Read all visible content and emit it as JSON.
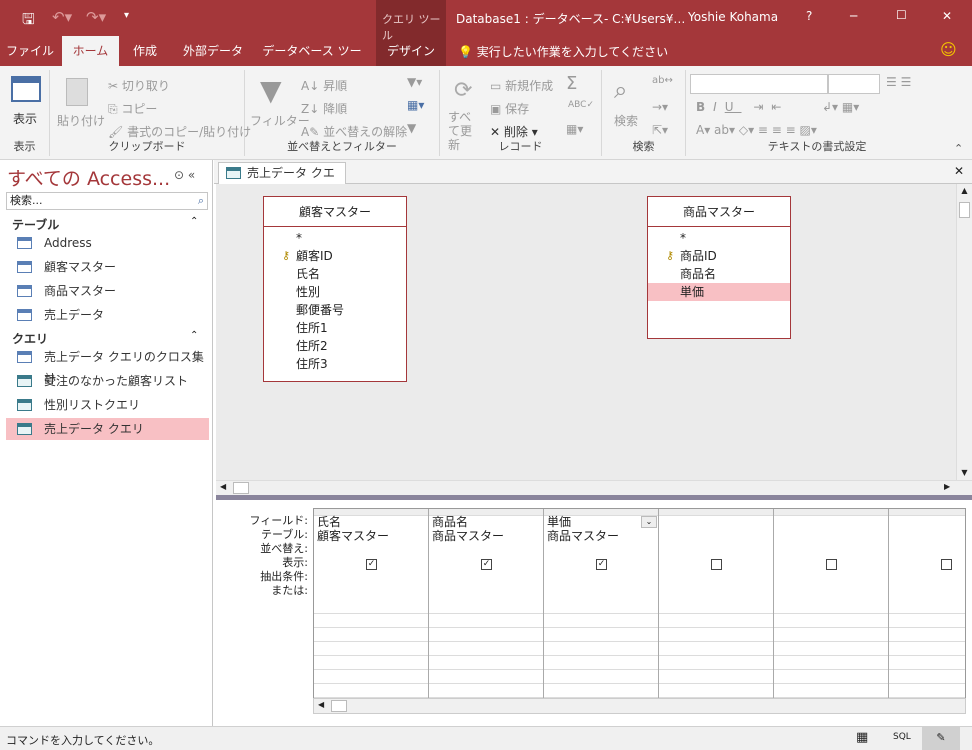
{
  "titlebar": {
    "context_tab": "クエリ ツール",
    "title": "Database1 : データベース- C:¥Users¥…",
    "user": "Yoshie Kohama",
    "help": "?",
    "minimize": "─",
    "maximize": "☐",
    "close": "✕"
  },
  "tabs": [
    {
      "label": "ファイル"
    },
    {
      "label": "ホーム"
    },
    {
      "label": "作成"
    },
    {
      "label": "外部データ"
    },
    {
      "label": "データベース ツール"
    },
    {
      "label": "デザイン"
    }
  ],
  "tell_me": "実行したい作業を入力してください",
  "ribbon": {
    "view": {
      "label": "表示",
      "group": "表示"
    },
    "clipboard": {
      "paste": "貼り付け",
      "cut": "切り取り",
      "copy": "コピー",
      "format_painter": "書式のコピー/貼り付け",
      "group": "クリップボード"
    },
    "sort_filter": {
      "filter": "フィルター",
      "asc": "昇順",
      "desc": "降順",
      "clear_sort": "並べ替えの解除",
      "group": "並べ替えとフィルター"
    },
    "records": {
      "refresh_all": "すべて更新",
      "new": "新規作成",
      "save": "保存",
      "delete": "削除",
      "group": "レコード"
    },
    "find": {
      "find": "検索",
      "group": "検索"
    },
    "text_format": {
      "group": "テキストの書式設定"
    }
  },
  "nav": {
    "title": "すべての Access...",
    "search_placeholder": "検索...",
    "sections": [
      {
        "label": "テーブル",
        "items": [
          "Address",
          "顧客マスター",
          "商品マスター",
          "売上データ"
        ]
      },
      {
        "label": "クエリ",
        "items": [
          "売上データ クエリのクロス集計",
          "受注のなかった顧客リスト",
          "性別リストクエリ",
          "売上データ クエリ"
        ]
      }
    ]
  },
  "doc_tab": "売上データ クエリ",
  "tables": [
    {
      "name": "顧客マスター",
      "fields": [
        "*",
        "顧客ID",
        "氏名",
        "性別",
        "郵便番号",
        "住所1",
        "住所2",
        "住所3"
      ],
      "key": "顧客ID"
    },
    {
      "name": "商品マスター",
      "fields": [
        "*",
        "商品ID",
        "商品名",
        "単価"
      ],
      "key": "商品ID",
      "selected": "単価"
    }
  ],
  "grid": {
    "row_labels": [
      "フィールド:",
      "テーブル:",
      "並べ替え:",
      "表示:",
      "抽出条件:",
      "または:"
    ],
    "columns": [
      {
        "field": "氏名",
        "table": "顧客マスター",
        "show": true
      },
      {
        "field": "商品名",
        "table": "商品マスター",
        "show": true
      },
      {
        "field": "単価",
        "table": "商品マスター",
        "show": true
      },
      {
        "field": "",
        "table": "",
        "show": false
      },
      {
        "field": "",
        "table": "",
        "show": false
      },
      {
        "field": "",
        "table": "",
        "show": false
      }
    ]
  },
  "status": {
    "text": "コマンドを入力してください。",
    "sql": "SQL"
  },
  "colors": {
    "accent": "#a4373a",
    "selection": "#f8c0c4"
  }
}
